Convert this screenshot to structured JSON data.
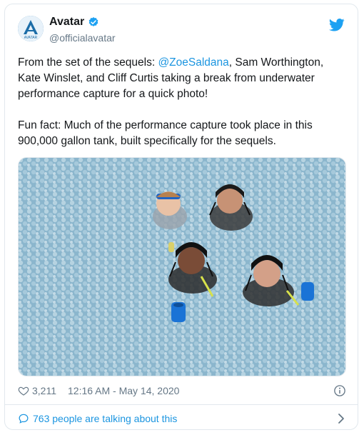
{
  "tweet": {
    "author_name": "Avatar",
    "author_handle": "@officialavatar",
    "verified": true,
    "avatar_text": "AVATAR",
    "text_part1": "From the set of the sequels: ",
    "mention": "@ZoeSaldana",
    "text_part2": ", Sam Worthington, Kate Winslet, and Cliff Curtis taking a break from underwater performance capture for a quick photo!\n\nFun fact: Much of the performance capture took place in this 900,000 gallon tank, built specifically for the sequels.",
    "likes": "3,211",
    "timestamp": "12:16 AM - May 14, 2020",
    "talking_label": "763 people are talking about this"
  },
  "icons": {
    "verified": "verified-badge-icon",
    "twitter": "twitter-bird-icon",
    "like": "heart-icon",
    "info": "info-icon",
    "reply": "speech-bubble-icon",
    "chevron": "chevron-right-icon"
  },
  "colors": {
    "link": "#1b95e0",
    "muted": "#657786",
    "border": "#e1e8ed",
    "water": "#8fb9cf"
  }
}
